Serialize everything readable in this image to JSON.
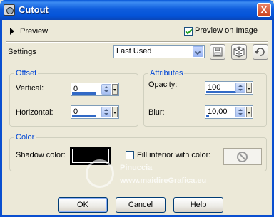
{
  "window": {
    "title": "Cutout",
    "close_glyph": "X",
    "icon": "app-icon"
  },
  "preview": {
    "label": "Preview",
    "preview_on_image_label": "Preview on Image",
    "preview_on_image_checked": true
  },
  "settings": {
    "label": "Settings",
    "selected": "Last Used",
    "buttons": [
      "save-preset-icon",
      "randomize-icon",
      "reset-icon"
    ]
  },
  "offset": {
    "title": "Offset",
    "vertical_label": "Vertical:",
    "vertical_value": "0",
    "horizontal_label": "Horizontal:",
    "horizontal_value": "0"
  },
  "attributes": {
    "title": "Attributes",
    "opacity_label": "Opacity:",
    "opacity_value": "100",
    "blur_label": "Blur:",
    "blur_value": "10,00"
  },
  "color": {
    "title": "Color",
    "shadow_color_label": "Shadow color:",
    "shadow_color": "#000000",
    "fill_interior_label": "Fill interior with color:",
    "fill_interior_checked": false
  },
  "buttons": {
    "ok": "OK",
    "cancel": "Cancel",
    "help": "Help"
  },
  "watermark": {
    "name": "Pinuccia",
    "url": "www.maidireGrafica.eu"
  }
}
